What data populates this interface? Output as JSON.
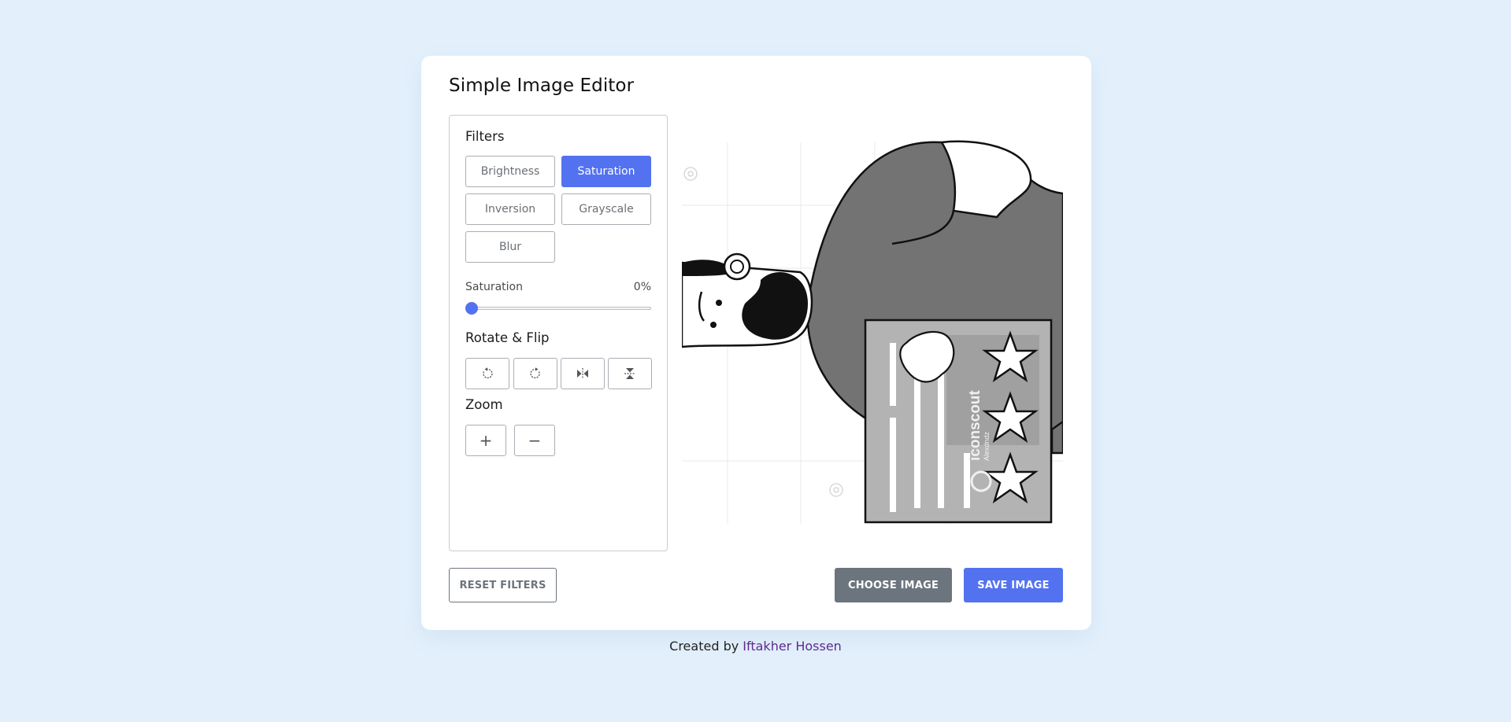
{
  "app": {
    "title": "Simple Image Editor"
  },
  "filters": {
    "heading": "Filters",
    "buttons": [
      {
        "label": "Brightness",
        "active": false
      },
      {
        "label": "Saturation",
        "active": true
      },
      {
        "label": "Inversion",
        "active": false
      },
      {
        "label": "Grayscale",
        "active": false
      },
      {
        "label": "Blur",
        "active": false
      }
    ],
    "slider": {
      "name": "Saturation",
      "value": "0%",
      "value_number": 0
    }
  },
  "rotate_flip": {
    "heading": "Rotate & Flip",
    "buttons": [
      "rotate-left-icon",
      "rotate-right-icon",
      "flip-horizontal-icon",
      "flip-vertical-icon"
    ]
  },
  "zoom": {
    "heading": "Zoom",
    "in_symbol": "+",
    "out_symbol": "−"
  },
  "preview": {
    "watermark_text": "iconscout",
    "watermark_sub": "Alexdndz"
  },
  "actions": {
    "reset_label": "RESET FILTERS",
    "choose_label": "CHOOSE IMAGE",
    "save_label": "SAVE IMAGE"
  },
  "footer": {
    "prefix": "Created by",
    "author": "Iftakher Hossen"
  },
  "colors": {
    "accent": "#5372f0",
    "secondary": "#6c757d",
    "background": "#e3f0fc",
    "author": "#5c2a8f"
  }
}
